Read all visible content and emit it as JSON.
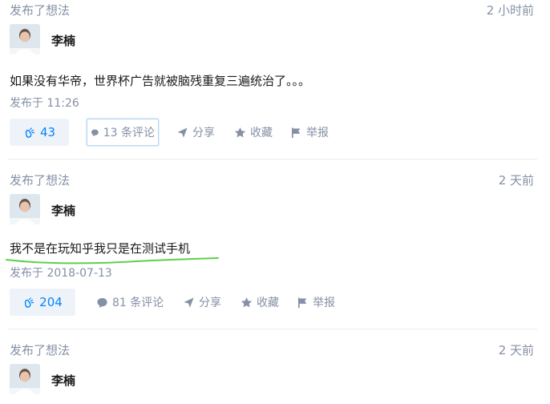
{
  "posts": [
    {
      "label": "发布了想法",
      "time": "2 小时前",
      "author": "李楠",
      "content": "如果没有华帝，世界杯广告就被脑残重复三遍统治了。。。",
      "posted": "发布于 11:26",
      "votes": "43",
      "comments": "13 条评论",
      "share": "分享",
      "favorite": "收藏",
      "report": "举报"
    },
    {
      "label": "发布了想法",
      "time": "2 天前",
      "author": "李楠",
      "content": "我不是在玩知乎我只是在测试手机",
      "posted": "发布于 2018-07-13",
      "votes": "204",
      "comments": "81 条评论",
      "share": "分享",
      "favorite": "收藏",
      "report": "举报"
    },
    {
      "label": "发布了想法",
      "time": "2 天前",
      "author": "李楠"
    }
  ],
  "colors": {
    "accent": "#0084ff",
    "meta": "#8590a6",
    "vote_bg": "#eef3fa",
    "annotation_underline": "#5ed04a"
  },
  "icons": {
    "vote": "clapping-hands-icon",
    "comment": "speech-bubble-icon",
    "share": "paper-plane-icon",
    "favorite": "star-icon",
    "report": "flag-icon"
  }
}
